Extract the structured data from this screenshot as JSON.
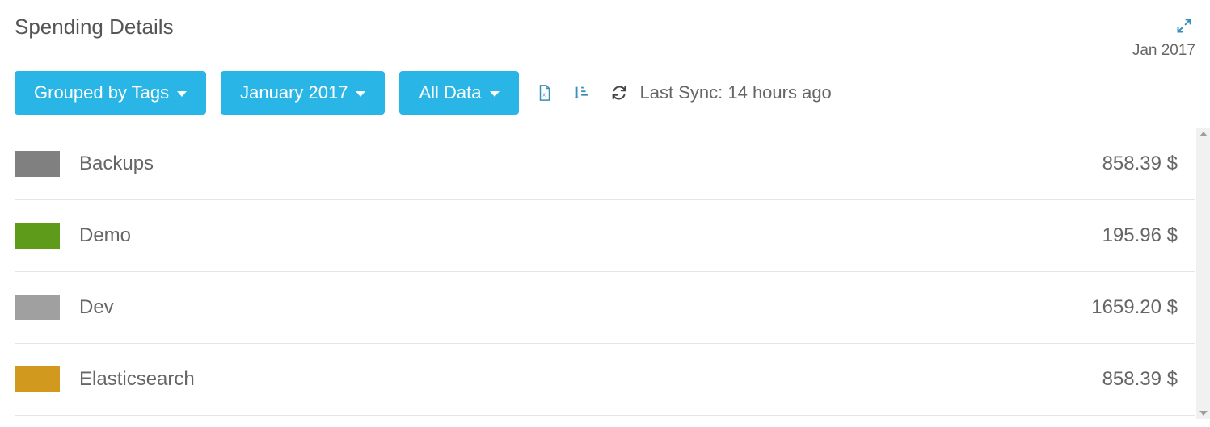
{
  "header": {
    "title": "Spending Details",
    "period_label": "Jan 2017"
  },
  "toolbar": {
    "group_label": "Grouped by Tags",
    "date_label": "January 2017",
    "filter_label": "All Data",
    "sync_text": "Last Sync: 14 hours ago"
  },
  "rows": [
    {
      "label": "Backups",
      "amount": "858.39 $",
      "color": "#808080"
    },
    {
      "label": "Demo",
      "amount": "195.96 $",
      "color": "#5f9b1b"
    },
    {
      "label": "Dev",
      "amount": "1659.20 $",
      "color": "#a0a0a0"
    },
    {
      "label": "Elasticsearch",
      "amount": "858.39 $",
      "color": "#d19a1f"
    }
  ]
}
